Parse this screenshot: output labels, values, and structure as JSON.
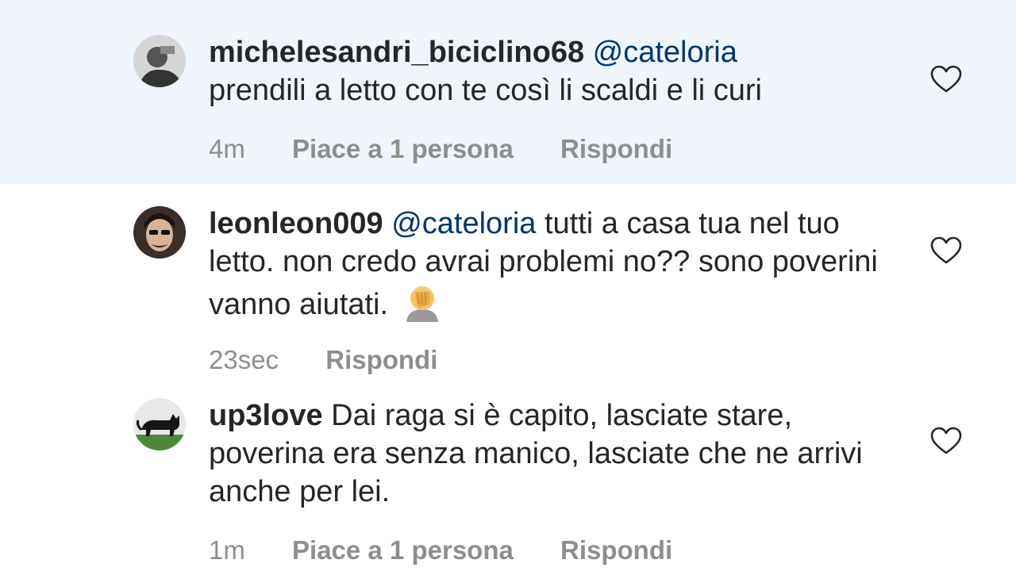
{
  "comments": [
    {
      "username": "michelesandri_biciclino68",
      "mention": "@cateloria",
      "text": "prendili a letto con te così li scaldi e li curi",
      "time": "4m",
      "likes": "Piace a 1 persona",
      "reply": "Rispondi",
      "avatar_icon": "user-avatar-icon",
      "highlighted": true
    },
    {
      "username": "leonleon009",
      "mention": "@cateloria",
      "text": "tutti a casa tua nel tuo letto. non credo avrai problemi no?? sono poverini vanno aiutati.",
      "emoji": "🤦",
      "emoji_icon": "facepalm-emoji-icon",
      "time": "23sec",
      "reply": "Rispondi",
      "avatar_icon": "user-avatar-icon"
    },
    {
      "username": "up3love",
      "text": "Dai raga si è capito, lasciate stare, poverina era senza manico, lasciate che ne arrivi anche per lei.",
      "time": "1m",
      "likes": "Piace a 1 persona",
      "reply": "Rispondi",
      "avatar_icon": "cat-avatar-icon"
    }
  ],
  "like_icon": "heart-outline-icon",
  "colors": {
    "highlight_bg": "#eff5fb",
    "text": "#262626",
    "mention": "#00376b",
    "meta": "#8e8e8e"
  }
}
